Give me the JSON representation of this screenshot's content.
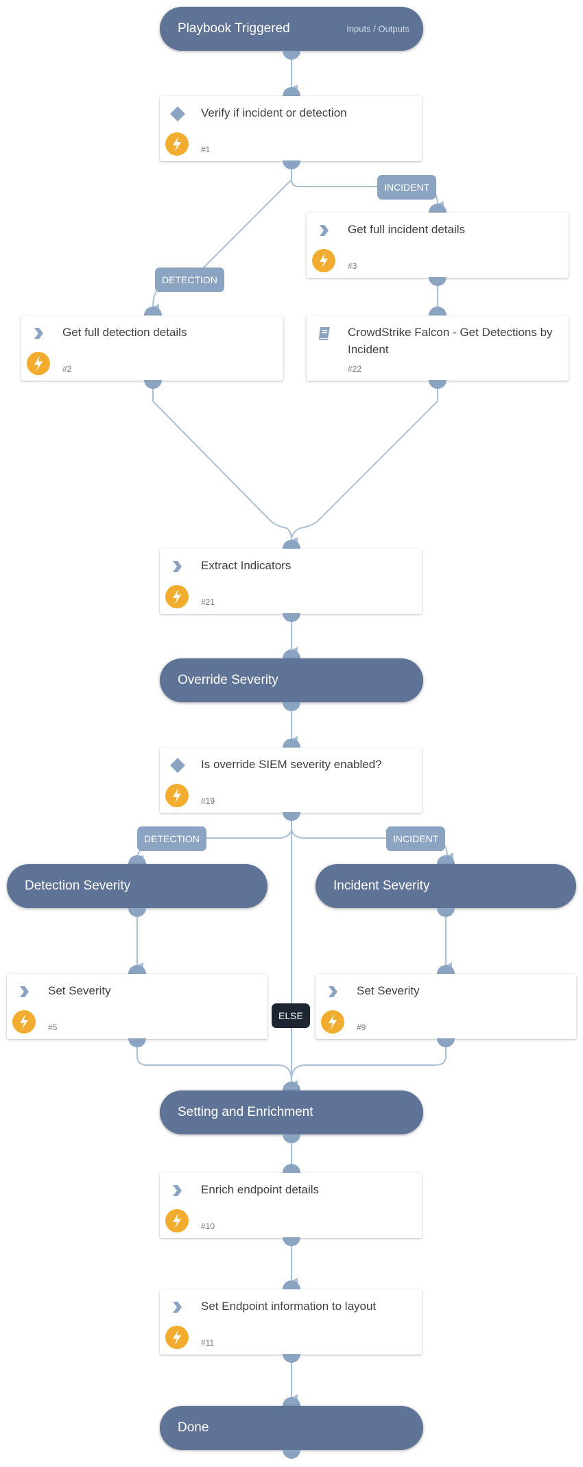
{
  "colors": {
    "band": "#5f7396",
    "port": "#8aa4c1",
    "edge": "#a9bfd6",
    "bolt": "#f2ac2f",
    "else_label": "#1e2532"
  },
  "start": {
    "title": "Playbook Triggered",
    "io_link": "Inputs / Outputs"
  },
  "sections": {
    "override": "Override Severity",
    "detection": "Detection Severity",
    "incident": "Incident Severity",
    "setting": "Setting and Enrichment",
    "done": "Done"
  },
  "tasks": {
    "t1": {
      "name": "Verify if incident or detection",
      "num": "#1",
      "icon": "condition-diamond-icon"
    },
    "t3": {
      "name": "Get full incident details",
      "num": "#3",
      "icon": "chevron-right-icon"
    },
    "t2": {
      "name": "Get full detection details",
      "num": "#2",
      "icon": "chevron-right-icon"
    },
    "t22": {
      "name": "CrowdStrike Falcon - Get Detections by Incident",
      "num": "#22",
      "icon": "book-icon"
    },
    "t21": {
      "name": "Extract Indicators",
      "num": "#21",
      "icon": "chevron-right-icon"
    },
    "t19": {
      "name": "Is override SIEM severity enabled?",
      "num": "#19",
      "icon": "condition-diamond-icon"
    },
    "t5": {
      "name": "Set Severity",
      "num": "#5",
      "icon": "chevron-right-icon"
    },
    "t9": {
      "name": "Set Severity",
      "num": "#9",
      "icon": "chevron-right-icon"
    },
    "t10": {
      "name": "Enrich endpoint details",
      "num": "#10",
      "icon": "chevron-right-icon"
    },
    "t11": {
      "name": "Set Endpoint information to layout",
      "num": "#11",
      "icon": "chevron-right-icon"
    }
  },
  "edge_labels": {
    "incident_1": "INCIDENT",
    "detection_1": "DETECTION",
    "detection_2": "DETECTION",
    "incident_2": "INCIDENT",
    "else": "ELSE"
  }
}
